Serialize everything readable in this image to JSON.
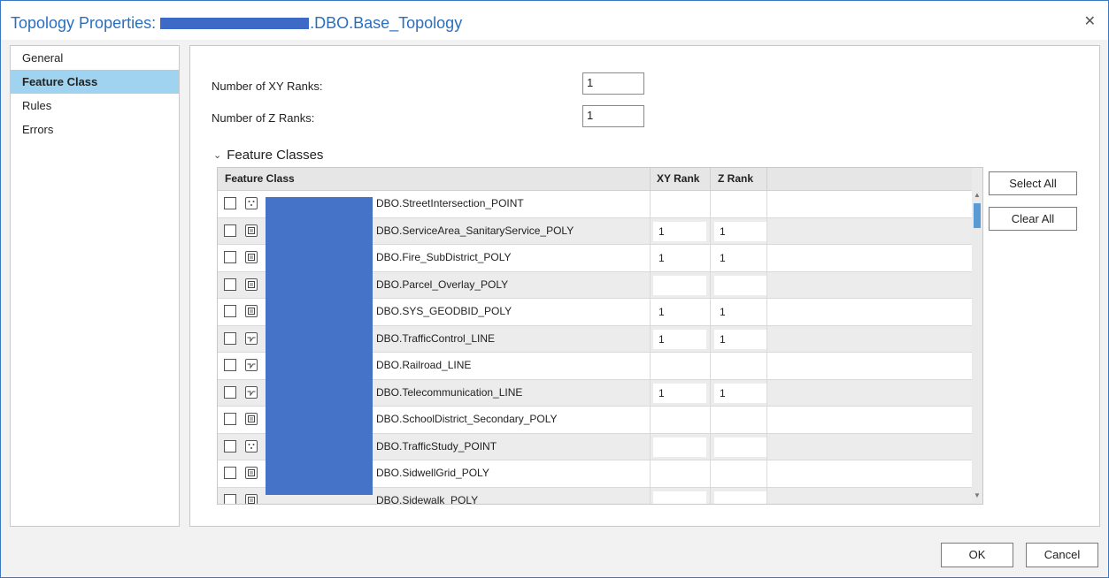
{
  "window": {
    "title_prefix": "Topology Properties:",
    "title_suffix": ".DBO.Base_Topology",
    "close_glyph": "✕"
  },
  "sidebar": {
    "items": [
      {
        "label": "General",
        "active": false
      },
      {
        "label": "Feature Class",
        "active": true
      },
      {
        "label": "Rules",
        "active": false
      },
      {
        "label": "Errors",
        "active": false
      }
    ]
  },
  "ranks": {
    "xy_label": "Number of XY Ranks:",
    "xy_value": "1",
    "z_label": "Number of Z Ranks:",
    "z_value": "1"
  },
  "section": {
    "title": "Feature Classes",
    "chevron": "⌄"
  },
  "table": {
    "headers": {
      "feature_class": "Feature Class",
      "xy_rank": "XY Rank",
      "z_rank": "Z Rank"
    },
    "rows": [
      {
        "name": "DBO.StreetIntersection_POINT",
        "geometry": "point",
        "xy": "",
        "z": "",
        "checked": false
      },
      {
        "name": "DBO.ServiceArea_SanitaryService_POLY",
        "geometry": "polygon",
        "xy": "1",
        "z": "1",
        "checked": false
      },
      {
        "name": "DBO.Fire_SubDistrict_POLY",
        "geometry": "polygon",
        "xy": "1",
        "z": "1",
        "checked": false
      },
      {
        "name": "DBO.Parcel_Overlay_POLY",
        "geometry": "polygon",
        "xy": "",
        "z": "",
        "checked": false
      },
      {
        "name": "DBO.SYS_GEODBID_POLY",
        "geometry": "polygon",
        "xy": "1",
        "z": "1",
        "checked": false
      },
      {
        "name": "DBO.TrafficControl_LINE",
        "geometry": "line",
        "xy": "1",
        "z": "1",
        "checked": false
      },
      {
        "name": "DBO.Railroad_LINE",
        "geometry": "line",
        "xy": "",
        "z": "",
        "checked": false
      },
      {
        "name": "DBO.Telecommunication_LINE",
        "geometry": "line",
        "xy": "1",
        "z": "1",
        "checked": false
      },
      {
        "name": "DBO.SchoolDistrict_Secondary_POLY",
        "geometry": "polygon",
        "xy": "",
        "z": "",
        "checked": false
      },
      {
        "name": "DBO.TrafficStudy_POINT",
        "geometry": "point",
        "xy": "",
        "z": "",
        "checked": false
      },
      {
        "name": "DBO.SidwellGrid_POLY",
        "geometry": "polygon",
        "xy": "",
        "z": "",
        "checked": false
      },
      {
        "name": "DBO.Sidewalk_POLY",
        "geometry": "polygon",
        "xy": "",
        "z": "",
        "checked": false
      }
    ]
  },
  "buttons": {
    "select_all": "Select All",
    "clear_all": "Clear All",
    "ok": "OK",
    "cancel": "Cancel"
  }
}
